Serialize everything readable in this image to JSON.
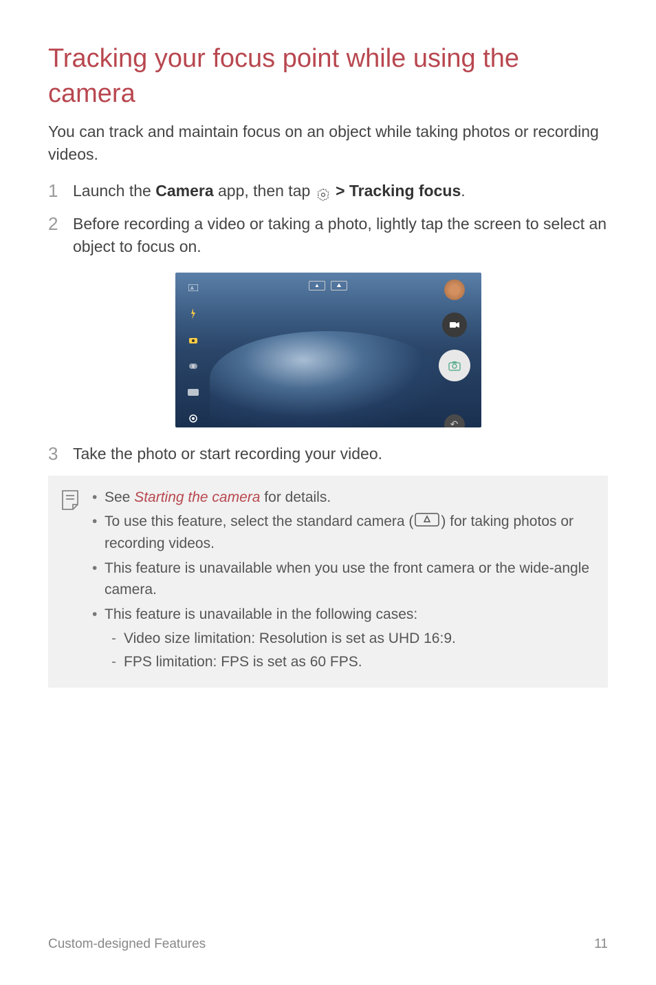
{
  "title": "Tracking your focus point while using the camera",
  "intro": "You can track and maintain focus on an object while taking photos or recording videos.",
  "steps": [
    {
      "num": "1",
      "prefix": "Launch the ",
      "bold1": "Camera",
      "mid": " app, then tap ",
      "connector": " ",
      "bold2": "Tracking focus",
      "suffix": "."
    },
    {
      "num": "2",
      "text": "Before recording a video or taking a photo, lightly tap the screen to select an object to focus on."
    },
    {
      "num": "3",
      "text": "Take the photo or start recording your video."
    }
  ],
  "notes": {
    "item1": {
      "prefix": "See ",
      "link": "Starting the camera",
      "suffix": " for details."
    },
    "item2": {
      "prefix": "To use this feature, select the standard camera (",
      "suffix": ") for taking photos or recording videos."
    },
    "item3": "This feature is unavailable when you use the front camera or the wide-angle camera.",
    "item4": {
      "text": "This feature is unavailable in the following cases:",
      "sub": [
        "Video size limitation: Resolution is set as UHD 16:9.",
        "FPS limitation: FPS is set as 60 FPS."
      ]
    }
  },
  "footer": {
    "left": "Custom-designed Features",
    "right": "11"
  },
  "gt_symbol": ">"
}
